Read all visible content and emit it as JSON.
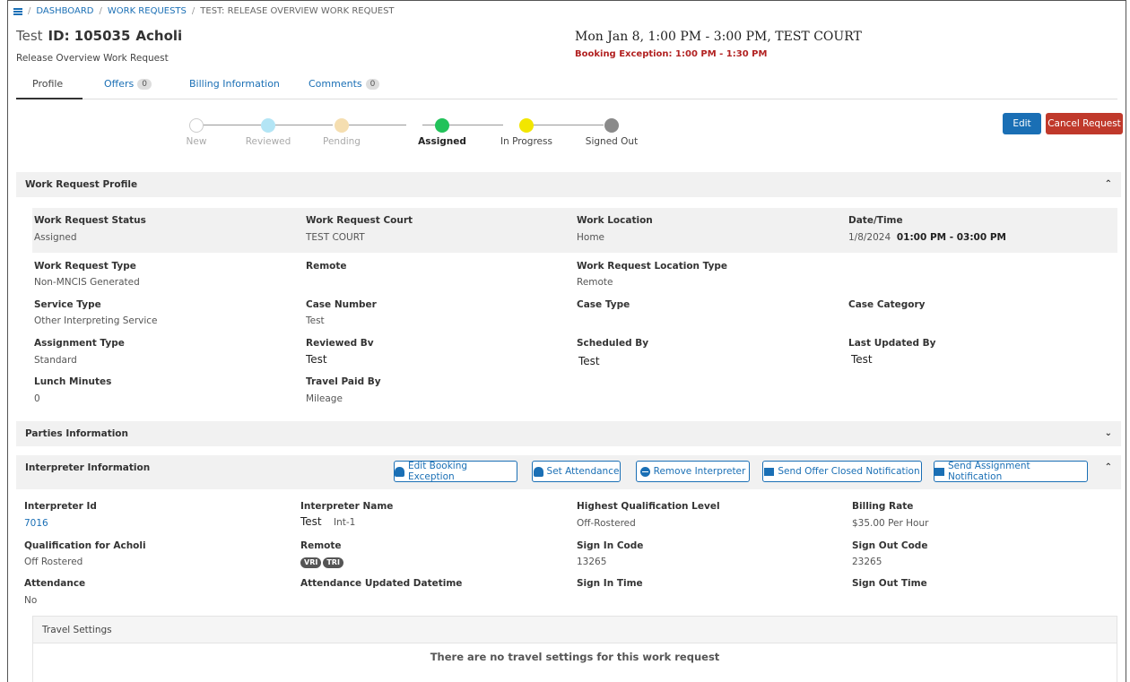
{
  "breadcrumb": {
    "items": [
      "DASHBOARD",
      "WORK REQUESTS"
    ],
    "current": "TEST: RELEASE OVERVIEW WORK REQUEST"
  },
  "header": {
    "name": "Test",
    "id_label": "ID: 105035",
    "language": "Acholi",
    "subtitle": "Release Overview Work Request",
    "datetime": "Mon Jan 8, 1:00 PM - 3:00 PM, TEST COURT",
    "booking_exception": "Booking Exception: 1:00 PM - 1:30 PM"
  },
  "tabs": [
    {
      "label": "Profile"
    },
    {
      "label": "Offers",
      "count": "0"
    },
    {
      "label": "Billing Information"
    },
    {
      "label": "Comments",
      "count": "0"
    }
  ],
  "status_steps": [
    {
      "label": "New",
      "color": "#ffffff"
    },
    {
      "label": "Reviewed",
      "color": "#b3e5f5"
    },
    {
      "label": "Pending",
      "color": "#f5deb0"
    },
    {
      "label": "Assigned",
      "color": "#22c25a"
    },
    {
      "label": "In Progress",
      "color": "#f2e600"
    },
    {
      "label": "Signed Out",
      "color": "#8a8a8a"
    }
  ],
  "actions": {
    "edit": "Edit",
    "cancel": "Cancel Request"
  },
  "profile": {
    "title": "Work Request Profile",
    "status_label": "Work Request Status",
    "status": "Assigned",
    "court_label": "Work Request Court",
    "court": "TEST COURT",
    "location_label": "Work Location",
    "location": "Home",
    "datetime_label": "Date/Time",
    "date": "1/8/2024",
    "time": "01:00 PM - 03:00 PM",
    "type_label": "Work Request Type",
    "type": "Non-MNCIS Generated",
    "remote_label": "Remote",
    "location_type_label": "Work Request Location Type",
    "location_type": "Remote",
    "service_type_label": "Service Type",
    "service_type": "Other Interpreting Service",
    "case_number_label": "Case Number",
    "case_number": "Test",
    "case_type_label": "Case Type",
    "case_category_label": "Case Category",
    "assignment_type_label": "Assignment Type",
    "assignment_type": "Standard",
    "reviewed_by_label": "Reviewed Bv",
    "reviewed_by": "Test",
    "scheduled_by_label": "Scheduled By",
    "scheduled_by": "Test",
    "last_updated_label": "Last Updated By",
    "last_updated": "Test",
    "lunch_label": "Lunch Minutes",
    "lunch": "0",
    "travel_paid_label": "Travel Paid By",
    "travel_paid": "Mileage"
  },
  "parties": {
    "title": "Parties Information"
  },
  "interpreter": {
    "title": "Interpreter Information",
    "buttons": {
      "edit_exception": "Edit Booking Exception",
      "set_attendance": "Set Attendance",
      "remove": "Remove Interpreter",
      "offer_closed": "Send Offer Closed Notification",
      "assignment": "Send Assignment Notification"
    },
    "id_label": "Interpreter Id",
    "id": "7016",
    "name_label": "Interpreter Name",
    "first_name": "Test",
    "last_name": "Int-1",
    "qual_level_label": "Highest Qualification Level",
    "qual_level": "Off-Rostered",
    "billing_label": "Billing Rate",
    "billing": "$35.00 Per Hour",
    "qual_for_label": "Qualification for Acholi",
    "qual_for": "Off Rostered",
    "remote_label": "Remote",
    "remote_badges": [
      "VRI",
      "TRI"
    ],
    "sign_in_code_label": "Sign In Code",
    "sign_in_code": "13265",
    "sign_out_code_label": "Sign Out Code",
    "sign_out_code": "23265",
    "attendance_label": "Attendance",
    "attendance": "No",
    "attendance_updated_label": "Attendance Updated Datetime",
    "sign_in_time_label": "Sign In Time",
    "sign_out_time_label": "Sign Out Time"
  },
  "travel": {
    "title": "Travel Settings",
    "empty": "There are no travel settings for this work request"
  }
}
